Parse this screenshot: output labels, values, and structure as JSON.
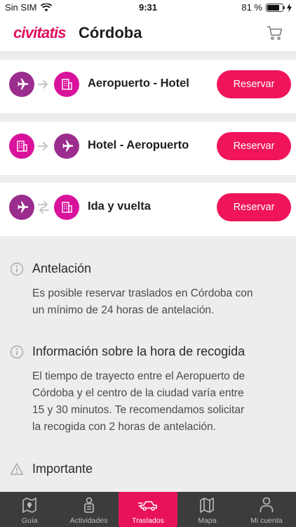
{
  "status": {
    "carrier": "Sin SIM",
    "time": "9:31",
    "battery": "81 %",
    "battery_level": 0.81
  },
  "header": {
    "brand": "civitatis",
    "city": "Córdoba",
    "cart_icon": "cart-icon"
  },
  "transfers": [
    {
      "title": "Aeropuerto - Hotel",
      "button": "Reservar",
      "from_icon": "plane-icon",
      "to_icon": "hotel-icon",
      "direction": "one-way"
    },
    {
      "title": "Hotel - Aeropuerto",
      "button": "Reservar",
      "from_icon": "hotel-icon",
      "to_icon": "plane-icon",
      "direction": "one-way"
    },
    {
      "title": "Ida y vuelta",
      "button": "Reservar",
      "from_icon": "plane-icon",
      "to_icon": "hotel-icon",
      "direction": "round-trip"
    }
  ],
  "info": [
    {
      "title": "Antelación",
      "icon": "info-icon",
      "body_lines": [
        "Es posible reservar traslados en Córdoba con",
        "un mínimo de 24 horas de antelación."
      ]
    },
    {
      "title": "Información sobre la hora de recogida",
      "icon": "info-icon",
      "body_lines": [
        "El tiempo de trayecto entre el Aeropuerto de",
        "Córdoba y el centro de la ciudad varía entre",
        "15 y 30 minutos. Te recomendamos solicitar",
        "la recogida con 2 horas de antelación."
      ]
    },
    {
      "title": "Importante",
      "icon": "warning-icon",
      "body_lines": []
    }
  ],
  "tabs": [
    {
      "label": "Guía",
      "icon": "map-book-icon",
      "active": false
    },
    {
      "label": "Actividades",
      "icon": "traveler-icon",
      "active": false
    },
    {
      "label": "Traslados",
      "icon": "transfer-car-icon",
      "active": true
    },
    {
      "label": "Mapa",
      "icon": "map-icon",
      "active": false
    },
    {
      "label": "Mi cuenta",
      "icon": "user-icon",
      "active": false
    }
  ],
  "colors": {
    "brand": "#e0115f",
    "button": "#f0145a",
    "plane_circle": "#9b2d8e",
    "hotel_circle": "#d8129b",
    "tabbar": "#3c3c3c"
  }
}
